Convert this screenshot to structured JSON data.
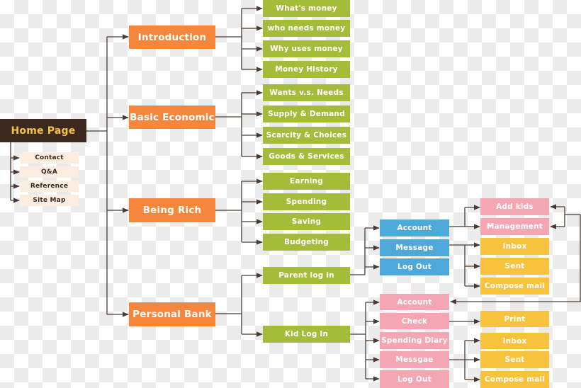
{
  "colors": {
    "home_bg": "#3c2a20",
    "home_text": "#f5c242",
    "utility_bg": "#fbeee0",
    "section": "#f5873d",
    "topic": "#a5bc3b",
    "parent": "#4ea9da",
    "kid": "#f4a6b2",
    "mail": "#f8c33c",
    "connector": "#4a3c34"
  },
  "home": {
    "label": "Home Page",
    "utility_links": [
      "Contact",
      "Q&A",
      "Reference",
      "Site Map"
    ]
  },
  "sections": [
    {
      "label": "Introduction",
      "children": [
        "What's money",
        "who needs money",
        "Why uses money",
        "Money History"
      ]
    },
    {
      "label": "Basic Economic",
      "children": [
        "Wants v.s. Needs",
        "Supply & Demand",
        "Scarcity & Choices",
        "Goods & Services"
      ]
    },
    {
      "label": "Being Rich",
      "children": [
        "Earning",
        "Spending",
        "Saving",
        "Budgeting"
      ]
    },
    {
      "label": "Personal Bank",
      "children": [
        "Parent log in",
        "Kid Log In"
      ]
    }
  ],
  "parent_menu": {
    "items": [
      "Account",
      "Message",
      "Log Out"
    ],
    "account_children": [
      "Add kids",
      "Management"
    ],
    "message_children": [
      "Inbox",
      "Sent",
      "Compose mail"
    ]
  },
  "kid_menu": {
    "items": [
      "Account",
      "Check",
      "Spending Diary",
      "Messgae",
      "Log Out"
    ],
    "check_children": [
      "Print"
    ],
    "message_children": [
      "Inbox",
      "Sent",
      "Compose mail"
    ]
  }
}
